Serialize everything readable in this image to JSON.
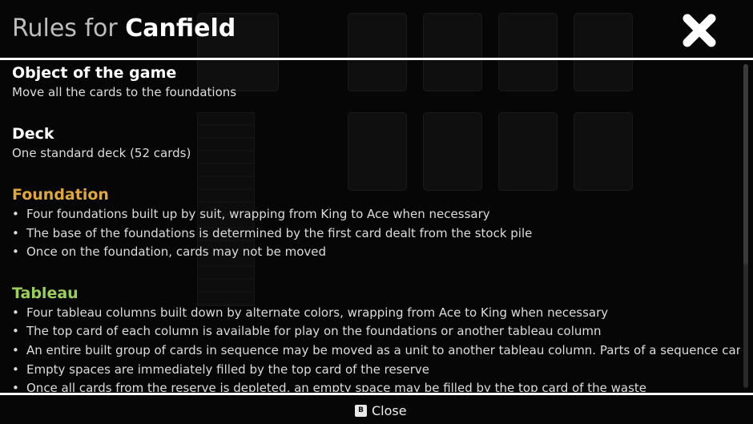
{
  "header": {
    "title_prefix": "Rules for",
    "title_game": "Canfield",
    "close_icon": "close-x-icon"
  },
  "sections": {
    "object": {
      "title": "Object of the game",
      "color": "#ffffff",
      "text": "Move all the cards to the foundations"
    },
    "deck": {
      "title": "Deck",
      "color": "#ffffff",
      "text": "One standard deck (52 cards)"
    },
    "foundation": {
      "title": "Foundation",
      "color": "#e0a83a",
      "items": [
        "Four foundations built up by suit, wrapping from King to Ace when necessary",
        "The base of the foundations is determined by the first card dealt from the stock pile",
        "Once on the foundation, cards may not be moved"
      ]
    },
    "tableau": {
      "title": "Tableau",
      "color": "#9ccf5a",
      "items": [
        "Four tableau columns built down by alternate colors, wrapping from Ace to King when necessary",
        "The top card of each column is available for play on the foundations or another tableau column",
        "An entire built group of cards in sequence may be moved as a unit to another tableau column. Parts of a sequence cannot be moved",
        "Empty spaces are immediately filled by the top card of the reserve",
        "Once all cards from the reserve is depleted, an empty space may be filled by the top card of the waste"
      ]
    }
  },
  "footer": {
    "button_key": "B",
    "close_label": "Close"
  }
}
